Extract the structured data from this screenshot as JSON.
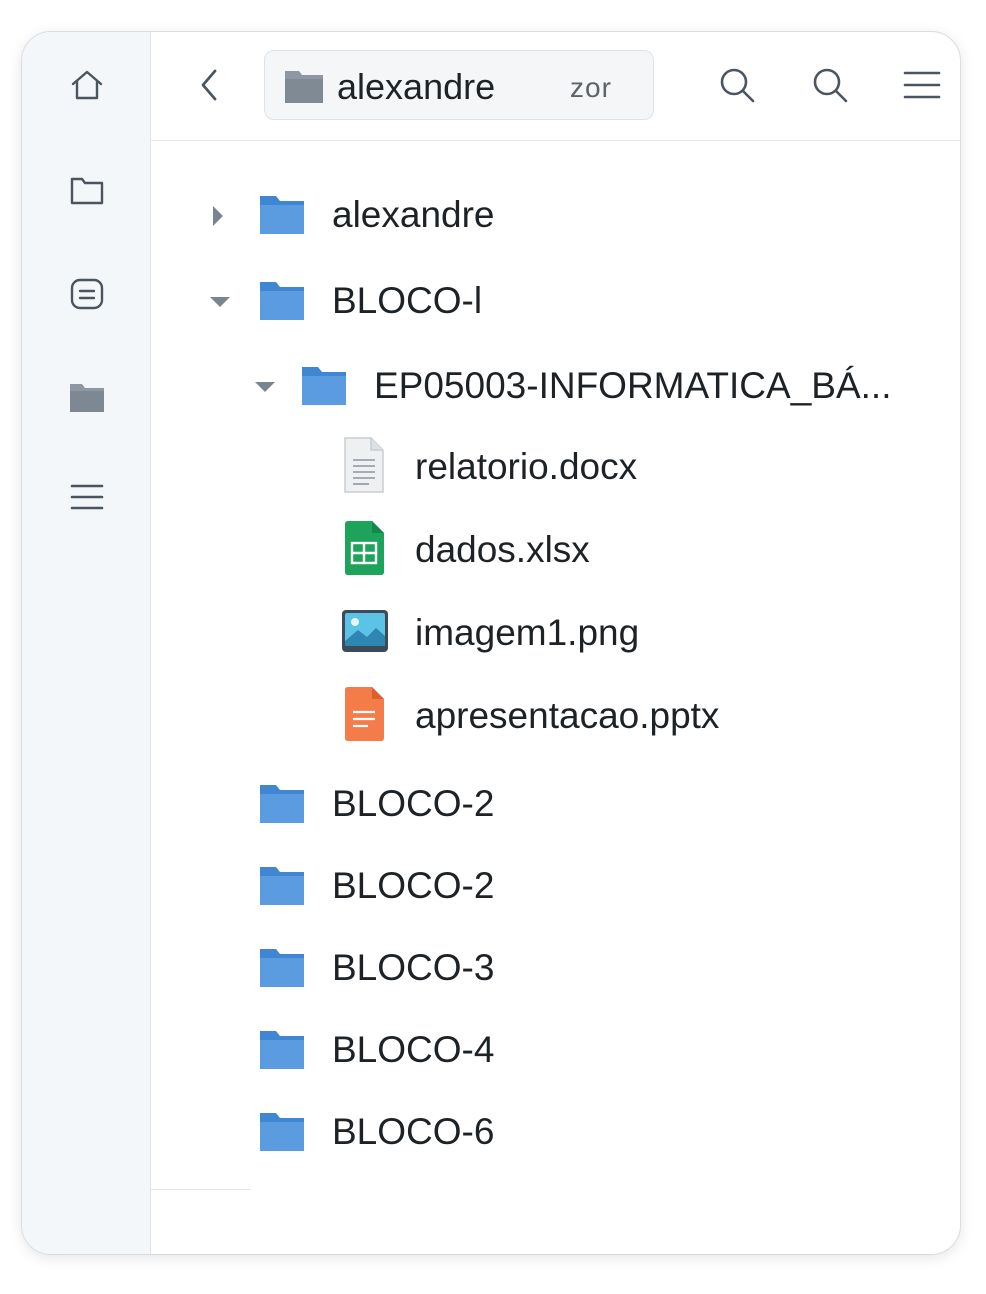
{
  "sidebar": {
    "items": [
      {
        "name": "home-icon"
      },
      {
        "name": "folder-outline-icon"
      },
      {
        "name": "notes-icon"
      },
      {
        "name": "folder-filled-icon"
      },
      {
        "name": "menu-icon"
      }
    ]
  },
  "toolbar": {
    "back_icon": "chevron-left-icon",
    "path_label": "alexandre",
    "path_extra": "zor",
    "icons": [
      "search-icon",
      "search-icon",
      "menu-icon"
    ]
  },
  "tree": {
    "items": [
      {
        "label": "alexandre",
        "kind": "folder",
        "toggle": "collapsed"
      },
      {
        "label": "BLOCO-l",
        "kind": "folder",
        "toggle": "expanded"
      },
      {
        "label": "EP05003-INFORMATICA_BÁ...",
        "kind": "folder",
        "toggle": "expanded"
      },
      {
        "label": "relatorio.docx",
        "kind": "document-file"
      },
      {
        "label": "dados.xlsx",
        "kind": "spreadsheet-file"
      },
      {
        "label": "imagem1.png",
        "kind": "image-file"
      },
      {
        "label": "apresentacao.pptx",
        "kind": "presentation-file"
      },
      {
        "label": "BLOCO-2",
        "kind": "folder"
      },
      {
        "label": "BLOCO-2",
        "kind": "folder"
      },
      {
        "label": "BLOCO-3",
        "kind": "folder"
      },
      {
        "label": "BLOCO-4",
        "kind": "folder"
      },
      {
        "label": "BLOCO-6",
        "kind": "folder"
      }
    ]
  },
  "colors": {
    "folder_blue": "#5b9be0",
    "spreadsheet_green": "#1ea35a",
    "presentation_orange": "#f47c48",
    "icon_gray": "#4b5560"
  }
}
